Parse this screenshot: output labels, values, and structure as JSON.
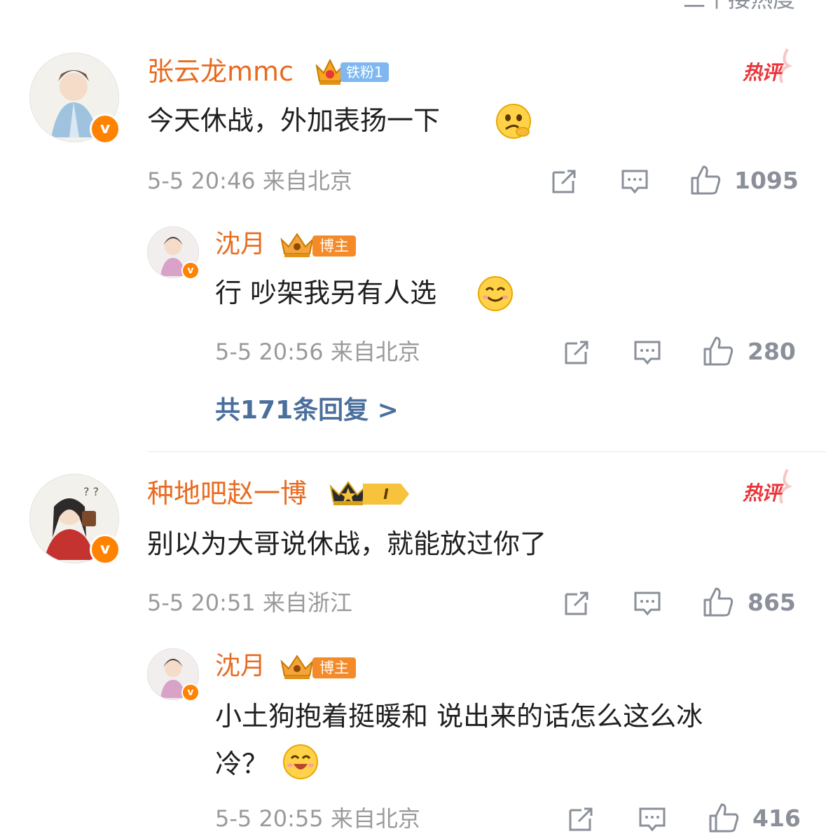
{
  "top_partial_text": "二个接热度",
  "comments": [
    {
      "username": "张云龙mmc",
      "fan_badge": "铁粉1",
      "hot_label": "热评",
      "text": "今天休战，外加表扬一下",
      "date": "5-5 20:46",
      "location": "来自北京",
      "likes": "1095",
      "reply": {
        "username": "沈月",
        "badge": "博主",
        "text": "行 吵架我另有人选",
        "date": "5-5 20:56",
        "location": "来自北京",
        "likes": "280"
      },
      "reply_total": "共171条回复 >"
    },
    {
      "username": "种地吧赵一博",
      "level_badge": "I",
      "hot_label": "热评",
      "text": "别以为大哥说休战，就能放过你了",
      "date": "5-5 20:51",
      "location": "来自浙江",
      "likes": "865",
      "reply": {
        "username": "沈月",
        "badge": "博主",
        "text_line1": "小土狗抱着挺暖和 说出来的话怎么这么冰",
        "text_line2": "冷？",
        "date": "5-5 20:55",
        "location": "来自北京",
        "likes": "416"
      }
    }
  ],
  "verified_mark": "v",
  "icons": [
    "share-icon",
    "comment-icon",
    "like-icon",
    "crown-icon",
    "verified-icon",
    "emoji-icon"
  ],
  "colors": {
    "username": "#e86b1f",
    "hot": "#e8363b",
    "meta": "#9a9a9a",
    "reply_link": "#4a6f9c",
    "verified": "#ff8200"
  }
}
